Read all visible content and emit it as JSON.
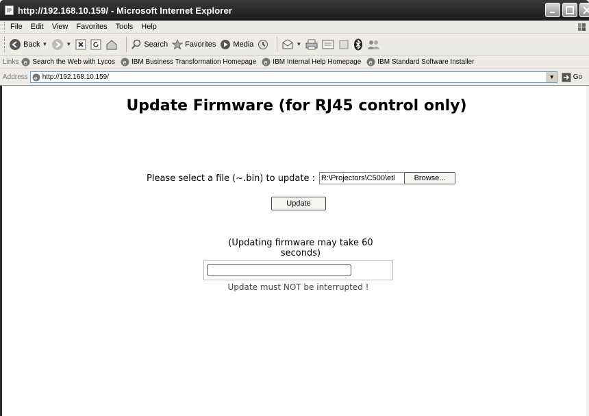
{
  "window": {
    "title": "http://192.168.10.159/ - Microsoft Internet Explorer"
  },
  "menubar": {
    "items": [
      "File",
      "Edit",
      "View",
      "Favorites",
      "Tools",
      "Help"
    ]
  },
  "toolbar": {
    "back_label": "Back",
    "search_label": "Search",
    "favorites_label": "Favorites",
    "media_label": "Media"
  },
  "links": {
    "label": "Links",
    "items": [
      "Search the Web with Lycos",
      "IBM Business Transformation Homepage",
      "IBM Internal Help Homepage",
      "IBM Standard Software Installer"
    ]
  },
  "address": {
    "label": "Address",
    "url": "http://192.168.10.159/",
    "go_label": "Go"
  },
  "page": {
    "title": "Update Firmware (for RJ45 control only)",
    "file_prompt": "Please select a file (~.bin) to update :",
    "file_value": "R:\\Projectors\\C500\\etl",
    "browse_label": "Browse...",
    "update_label": "Update",
    "note": "(Updating firmware may take 60 seconds)",
    "progress": 0,
    "warning": "Update must NOT be interrupted  !"
  }
}
